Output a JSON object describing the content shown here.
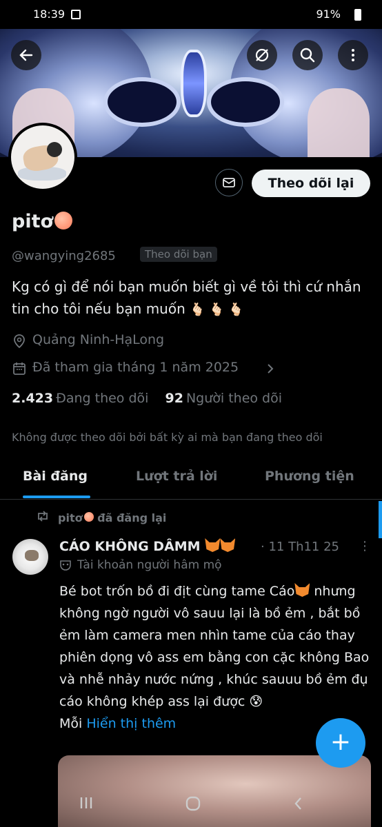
{
  "status_bar": {
    "time": "18:39",
    "battery": "91%"
  },
  "profile": {
    "name": "pitơ",
    "handle": "@wangying2685",
    "follows_you": "Theo dõi bạn",
    "follow_back_label": "Theo dõi lại",
    "bio": "Kg có gì để nói bạn muốn biết gì về tôi thì cứ nhắn tin cho tôi nếu bạn muốn",
    "bio_emoji": "🫰🏻 🫰🏻 🫰🏻",
    "location": "Quảng Ninh-HạLong",
    "joined": "Đã tham gia tháng 1 năm 2025",
    "following_count": "2.423",
    "following_label": "Đang theo dõi",
    "followers_count": "92",
    "followers_label": "Người theo dõi",
    "not_followed_note": "Không được theo dõi bởi bất kỳ ai mà bạn đang theo dõi"
  },
  "tabs": [
    {
      "label": "Bài đăng",
      "active": true
    },
    {
      "label": "Lượt trả lời",
      "active": false
    },
    {
      "label": "Phương tiện",
      "active": false
    }
  ],
  "post": {
    "repost_by": "pitơ",
    "repost_label": "đã đăng lại",
    "author": "CÁO KHÔNG DÂMM",
    "date": "· 11 Th11 25",
    "fan_account": "Tài khoản người hâm mộ",
    "text_1": "Bé bot trốn bồ đi địt cùng tame Cáo",
    "text_2": "nhưng không ngờ người vô sauu lại là bồ ẻm , bắt bồ ẻm làm camera men nhìn tame của cáo thay phiên dọng vô ass em bằng con cặc không Bao và nhễ nhảy nước nứng , khúc sauuu bồ ẻm đụ cáo không khép ass lại được",
    "emoji_end": "😰",
    "text_prefix": "Mỗi",
    "show_more": "Hiển thị thêm"
  },
  "fab": {
    "label": "+"
  },
  "colors": {
    "accent": "#1d9bf0",
    "bg": "#000000",
    "muted": "#71767b"
  }
}
